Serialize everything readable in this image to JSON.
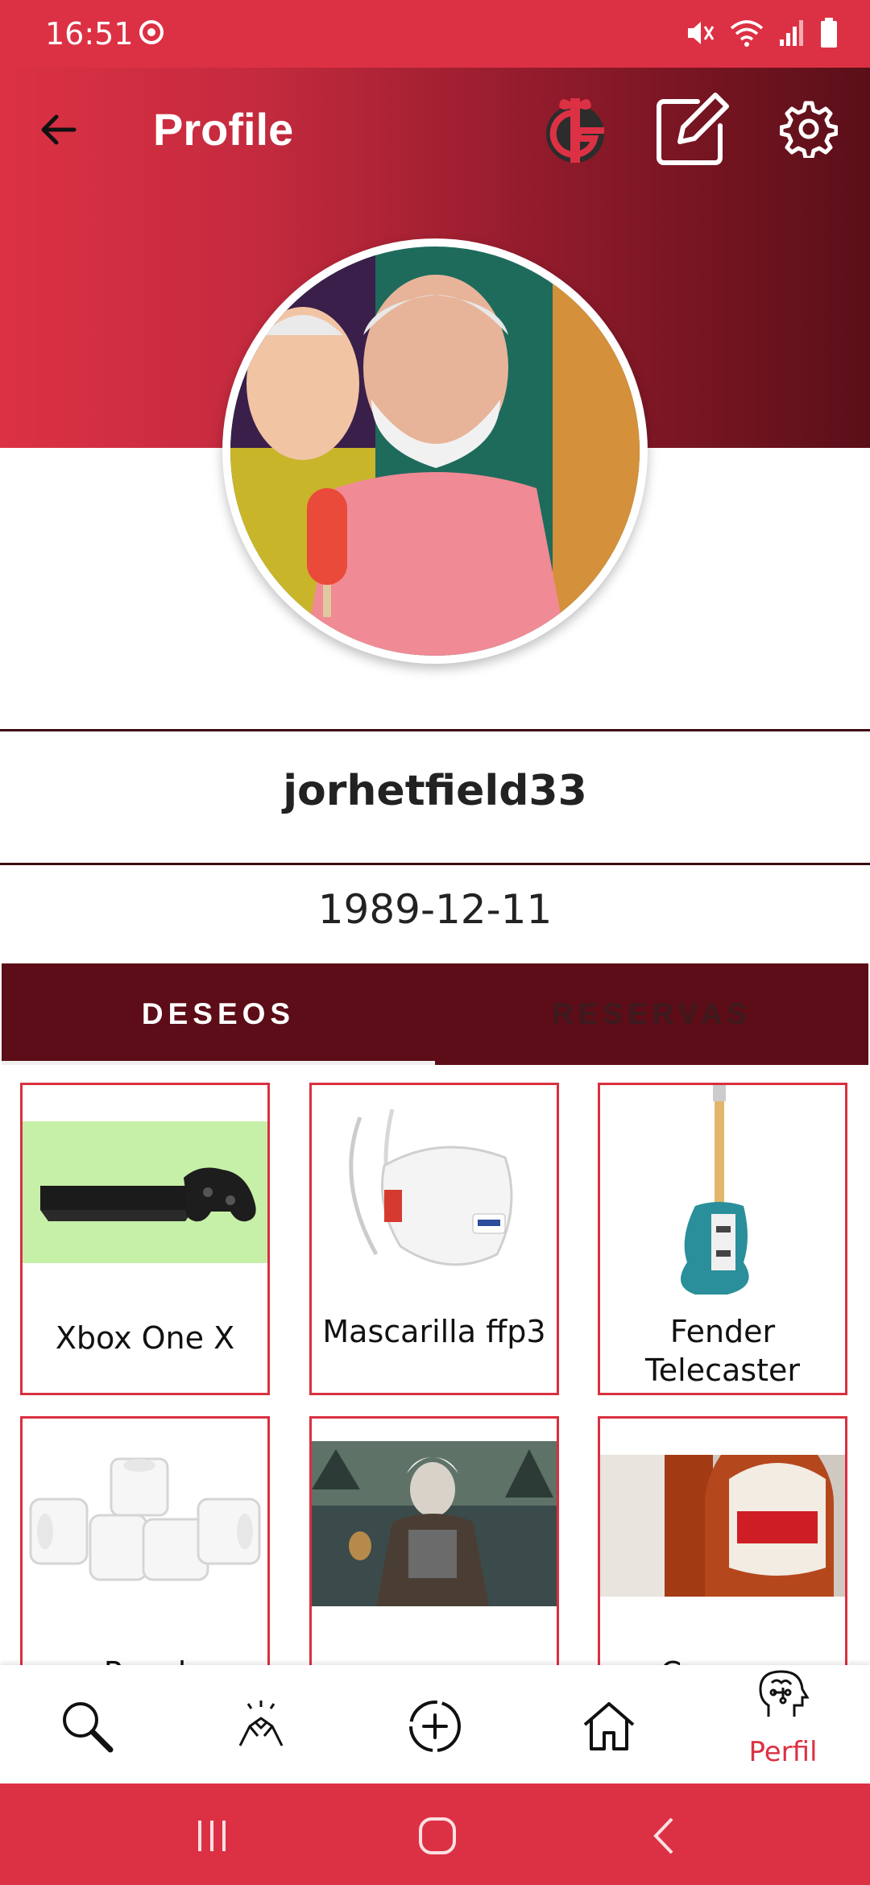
{
  "status": {
    "time": "16:51"
  },
  "header": {
    "title": "Profile"
  },
  "profile": {
    "username": "jorhetfield33",
    "birthdate": "1989-12-11"
  },
  "tabs": [
    {
      "label": "DESEOS"
    },
    {
      "label": "RESERVAS"
    }
  ],
  "wishlist": [
    {
      "name": "Xbox One X",
      "image": "xbox-console-image"
    },
    {
      "name": "Mascarilla ffp3",
      "image": "face-mask-image"
    },
    {
      "name": "Fender Telecaster",
      "image": "electric-guitar-image"
    },
    {
      "name": "Papel",
      "image": "toilet-paper-image"
    },
    {
      "name": "",
      "image": "witcher-game-image"
    },
    {
      "name": "Cerveza",
      "image": "beer-bottles-image"
    }
  ],
  "nav": {
    "profile_label": "Perfil"
  },
  "colors": {
    "accent": "#dc3144",
    "dark": "#5c0d17"
  },
  "icons": [
    "back-arrow-icon",
    "gift-logo-icon",
    "edit-icon",
    "settings-gear-icon",
    "search-icon",
    "handshake-icon",
    "add-circle-icon",
    "home-icon",
    "brain-profile-icon"
  ]
}
